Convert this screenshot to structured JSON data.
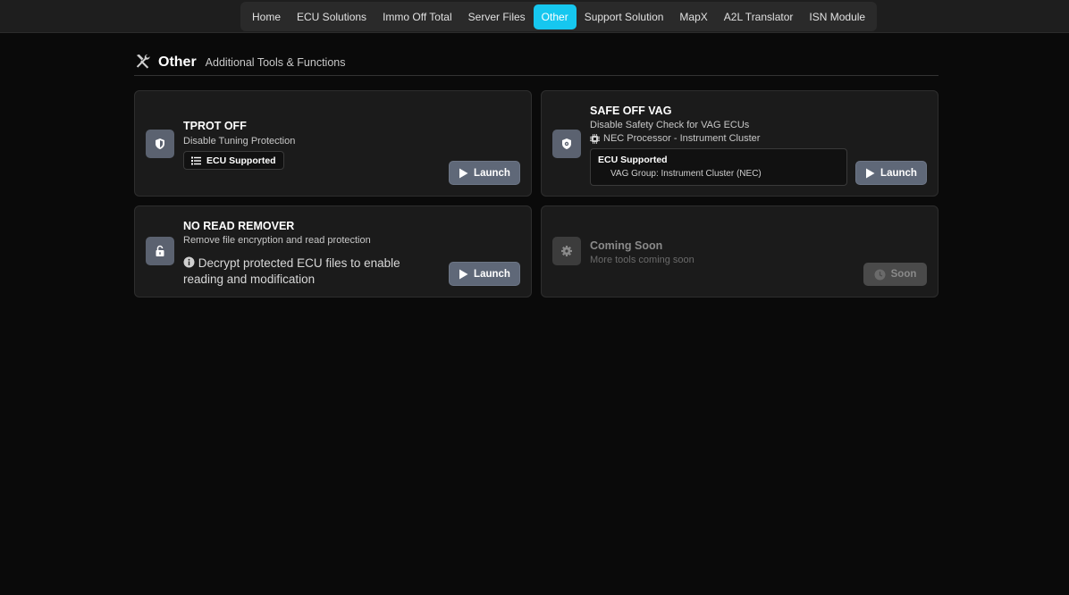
{
  "nav": {
    "items": [
      {
        "label": "Home"
      },
      {
        "label": "ECU Solutions"
      },
      {
        "label": "Immo Off Total"
      },
      {
        "label": "Server Files"
      },
      {
        "label": "Other",
        "active": true
      },
      {
        "label": "Support Solution"
      },
      {
        "label": "MapX"
      },
      {
        "label": "A2L Translator"
      },
      {
        "label": "ISN Module"
      }
    ],
    "active_color": "#16c7ef"
  },
  "section": {
    "title": "Other",
    "subtitle": "Additional Tools & Functions",
    "icon": "tools-icon"
  },
  "cards": {
    "tprot": {
      "title": "TPROT OFF",
      "desc": "Disable Tuning Protection",
      "icon": "shield-icon",
      "badge": "ECU Supported",
      "launch": "Launch"
    },
    "safe_off": {
      "title": "SAFE OFF VAG",
      "desc": "Disable Safety Check for VAG ECUs",
      "icon": "shield-gear-icon",
      "processor": "NEC Processor - Instrument Cluster",
      "support_heading": "ECU Supported",
      "support_value": "VAG Group: Instrument Cluster (NEC)",
      "launch": "Launch"
    },
    "no_read": {
      "title": "NO READ REMOVER",
      "desc": "Remove file encryption and read protection",
      "icon": "unlock-icon",
      "note_line1": "Decrypt protected ECU files to enable",
      "note_line2": "reading and modification",
      "launch": "Launch"
    },
    "coming_soon": {
      "title": "Coming Soon",
      "desc": "More tools coming soon",
      "icon": "gear-icon",
      "button": "Soon"
    }
  }
}
